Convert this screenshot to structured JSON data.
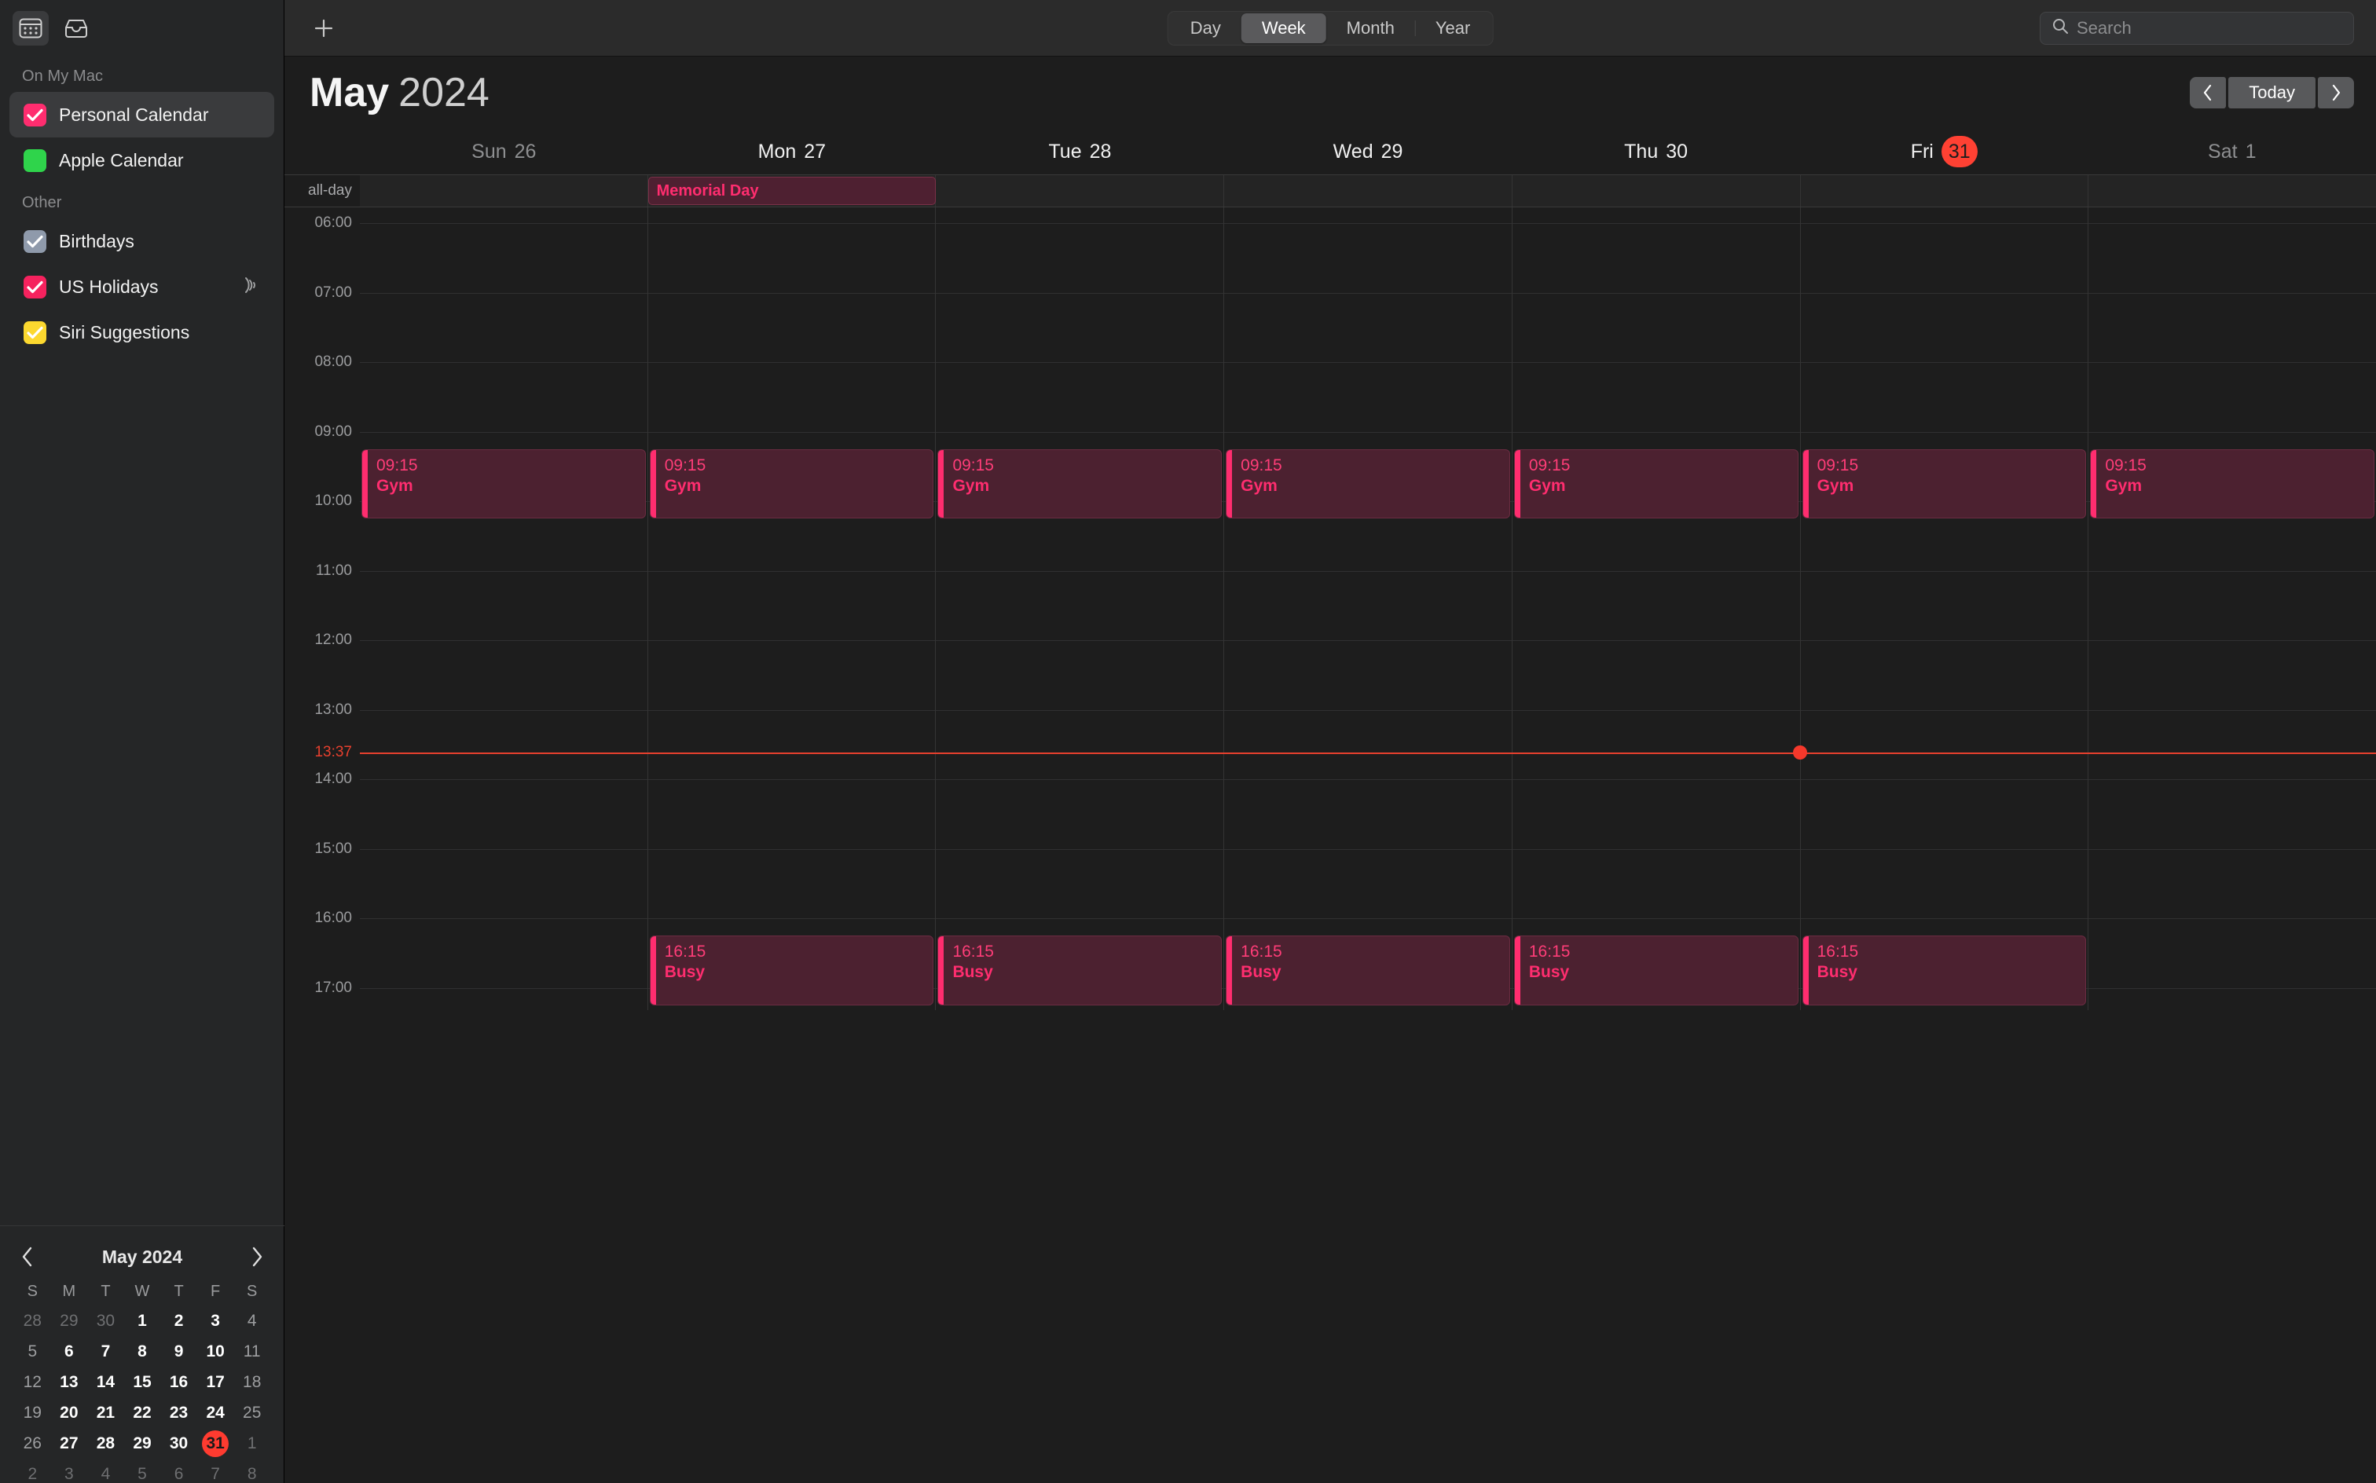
{
  "window": {
    "sidebar_icons": [
      {
        "name": "calendar-view-icon",
        "active": true
      },
      {
        "name": "inbox-icon",
        "active": false
      }
    ]
  },
  "sidebar": {
    "sections": [
      {
        "title": "On My Mac",
        "items": [
          {
            "label": "Personal Calendar",
            "color": "#ff2d6f",
            "checked": true,
            "selected": true,
            "subscribed": false
          },
          {
            "label": "Apple Calendar",
            "color": "#2fd44b",
            "checked": false,
            "selected": false,
            "subscribed": false
          }
        ]
      },
      {
        "title": "Other",
        "items": [
          {
            "label": "Birthdays",
            "color": "#8f9aab",
            "checked": true,
            "selected": false,
            "subscribed": false
          },
          {
            "label": "US Holidays",
            "color": "#f5225e",
            "checked": true,
            "selected": false,
            "subscribed": true
          },
          {
            "label": "Siri Suggestions",
            "color": "#fcd82f",
            "checked": true,
            "selected": false,
            "subscribed": false
          }
        ]
      }
    ],
    "mini_calendar": {
      "title": "May 2024",
      "prev_label": "‹",
      "next_label": "›",
      "day_initials": [
        "S",
        "M",
        "T",
        "W",
        "T",
        "F",
        "S"
      ],
      "weeks": [
        [
          {
            "d": "28",
            "t": "dim"
          },
          {
            "d": "29",
            "t": "dim"
          },
          {
            "d": "30",
            "t": "dim"
          },
          {
            "d": "1",
            "t": "wd"
          },
          {
            "d": "2",
            "t": "wd"
          },
          {
            "d": "3",
            "t": "wd"
          },
          {
            "d": "4",
            "t": "we"
          }
        ],
        [
          {
            "d": "5",
            "t": "we"
          },
          {
            "d": "6",
            "t": "wd"
          },
          {
            "d": "7",
            "t": "wd"
          },
          {
            "d": "8",
            "t": "wd"
          },
          {
            "d": "9",
            "t": "wd"
          },
          {
            "d": "10",
            "t": "wd"
          },
          {
            "d": "11",
            "t": "we"
          }
        ],
        [
          {
            "d": "12",
            "t": "we"
          },
          {
            "d": "13",
            "t": "wd"
          },
          {
            "d": "14",
            "t": "wd"
          },
          {
            "d": "15",
            "t": "wd"
          },
          {
            "d": "16",
            "t": "wd"
          },
          {
            "d": "17",
            "t": "wd"
          },
          {
            "d": "18",
            "t": "we"
          }
        ],
        [
          {
            "d": "19",
            "t": "we"
          },
          {
            "d": "20",
            "t": "wd"
          },
          {
            "d": "21",
            "t": "wd"
          },
          {
            "d": "22",
            "t": "wd"
          },
          {
            "d": "23",
            "t": "wd"
          },
          {
            "d": "24",
            "t": "wd"
          },
          {
            "d": "25",
            "t": "we"
          }
        ],
        [
          {
            "d": "26",
            "t": "we"
          },
          {
            "d": "27",
            "t": "wd"
          },
          {
            "d": "28",
            "t": "wd"
          },
          {
            "d": "29",
            "t": "wd"
          },
          {
            "d": "30",
            "t": "wd"
          },
          {
            "d": "31",
            "t": "today"
          },
          {
            "d": "1",
            "t": "dim"
          }
        ],
        [
          {
            "d": "2",
            "t": "dim"
          },
          {
            "d": "3",
            "t": "dim"
          },
          {
            "d": "4",
            "t": "dim"
          },
          {
            "d": "5",
            "t": "dim"
          },
          {
            "d": "6",
            "t": "dim"
          },
          {
            "d": "7",
            "t": "dim"
          },
          {
            "d": "8",
            "t": "dim"
          }
        ]
      ]
    }
  },
  "toolbar": {
    "add_label": "+",
    "views": [
      {
        "label": "Day",
        "active": false
      },
      {
        "label": "Week",
        "active": true
      },
      {
        "label": "Month",
        "active": false
      },
      {
        "label": "Year",
        "active": false
      }
    ],
    "search": {
      "value": "",
      "placeholder": "Search"
    }
  },
  "header": {
    "month": "May",
    "year": "2024",
    "prev_label": "‹",
    "today_label": "Today",
    "next_label": "›"
  },
  "week": {
    "all_day_label": "all-day",
    "days": [
      {
        "weekday": "Sun",
        "date": "26",
        "dim": true,
        "today": false
      },
      {
        "weekday": "Mon",
        "date": "27",
        "dim": false,
        "today": false
      },
      {
        "weekday": "Tue",
        "date": "28",
        "dim": false,
        "today": false
      },
      {
        "weekday": "Wed",
        "date": "29",
        "dim": false,
        "today": false
      },
      {
        "weekday": "Thu",
        "date": "30",
        "dim": false,
        "today": false
      },
      {
        "weekday": "Fri",
        "date": "31",
        "dim": false,
        "today": true
      },
      {
        "weekday": "Sat",
        "date": "1",
        "dim": true,
        "today": false
      }
    ],
    "all_day_events": [
      {
        "title": "Memorial Day",
        "start_col": 1,
        "span": 1
      }
    ],
    "hours": [
      "06:00",
      "07:00",
      "08:00",
      "09:00",
      "10:00",
      "11:00",
      "12:00",
      "13:00",
      "14:00",
      "15:00",
      "16:00",
      "17:00"
    ],
    "current_time": {
      "label": "13:37",
      "hour": 13,
      "minute": 37,
      "day_col": 5,
      "color": "#e8402e"
    },
    "events": [
      {
        "time": "09:15",
        "title": "Gym",
        "col": 0,
        "start_hour": 9.25,
        "end_hour": 10.25
      },
      {
        "time": "09:15",
        "title": "Gym",
        "col": 1,
        "start_hour": 9.25,
        "end_hour": 10.25
      },
      {
        "time": "09:15",
        "title": "Gym",
        "col": 2,
        "start_hour": 9.25,
        "end_hour": 10.25
      },
      {
        "time": "09:15",
        "title": "Gym",
        "col": 3,
        "start_hour": 9.25,
        "end_hour": 10.25
      },
      {
        "time": "09:15",
        "title": "Gym",
        "col": 4,
        "start_hour": 9.25,
        "end_hour": 10.25
      },
      {
        "time": "09:15",
        "title": "Gym",
        "col": 5,
        "start_hour": 9.25,
        "end_hour": 10.25
      },
      {
        "time": "09:15",
        "title": "Gym",
        "col": 6,
        "start_hour": 9.25,
        "end_hour": 10.25
      },
      {
        "time": "16:15",
        "title": "Busy",
        "col": 1,
        "start_hour": 16.25,
        "end_hour": 17.25
      },
      {
        "time": "16:15",
        "title": "Busy",
        "col": 2,
        "start_hour": 16.25,
        "end_hour": 17.25
      },
      {
        "time": "16:15",
        "title": "Busy",
        "col": 3,
        "start_hour": 16.25,
        "end_hour": 17.25
      },
      {
        "time": "16:15",
        "title": "Busy",
        "col": 4,
        "start_hour": 16.25,
        "end_hour": 17.25
      },
      {
        "time": "16:15",
        "title": "Busy",
        "col": 5,
        "start_hour": 16.25,
        "end_hour": 17.25
      }
    ]
  },
  "colors": {
    "accent_pink": "#ff2d6f",
    "event_bg": "#4c2130",
    "today_red": "#ff4133",
    "now_line": "#e8402e"
  }
}
